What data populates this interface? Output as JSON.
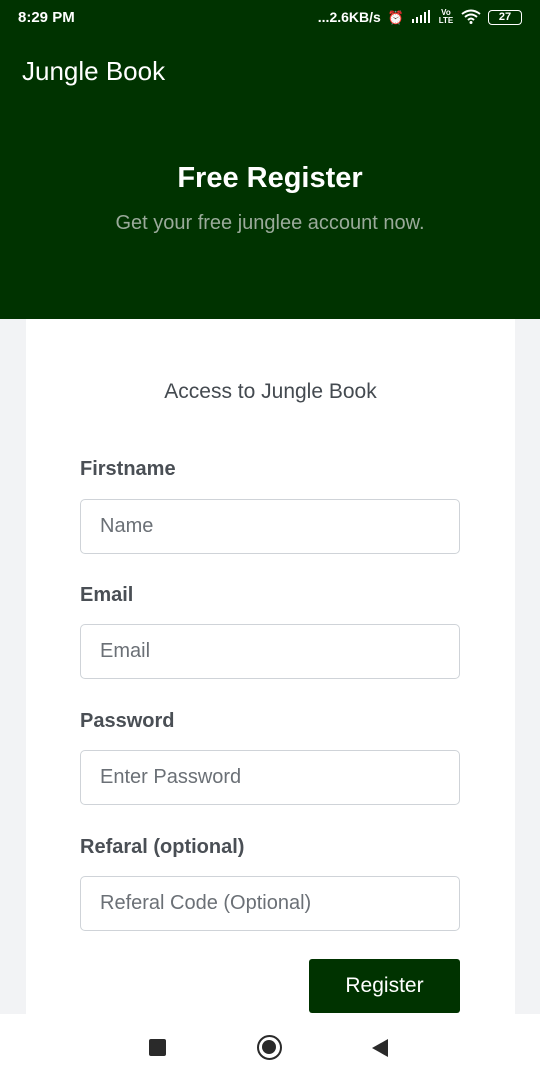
{
  "status_bar": {
    "time": "8:29 PM",
    "network_speed": "...2.6KB/s",
    "alarm_icon": "alarm-icon",
    "signal_icon": "signal-icon",
    "volte_label": "Vo LTE",
    "wifi_icon": "wifi-icon",
    "battery_level": "27"
  },
  "app": {
    "title": "Jungle Book",
    "brand_color": "#003300"
  },
  "hero": {
    "title": "Free Register",
    "subtitle": "Get your free junglee account now."
  },
  "form": {
    "heading": "Access to Jungle Book",
    "fields": [
      {
        "label": "Firstname",
        "placeholder": "Name",
        "value": ""
      },
      {
        "label": "Email",
        "placeholder": "Email",
        "value": ""
      },
      {
        "label": "Password",
        "placeholder": "Enter Password",
        "value": ""
      },
      {
        "label": "Refaral (optional)",
        "placeholder": "Referal Code (Optional)",
        "value": ""
      }
    ],
    "submit_label": "Register"
  },
  "nav_bar": {
    "recents_icon": "square-icon",
    "home_icon": "circle-icon",
    "back_icon": "back-triangle-icon"
  }
}
